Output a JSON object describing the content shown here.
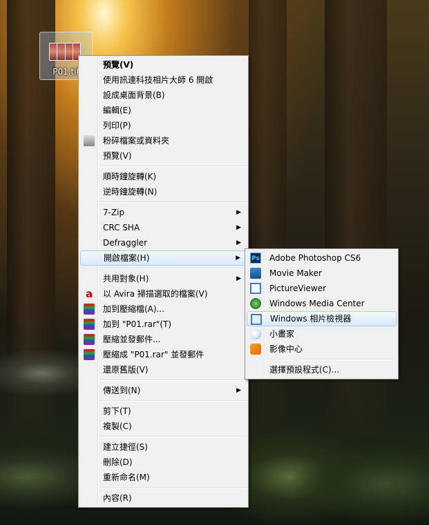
{
  "desktop": {
    "icon_label": "P01.tif"
  },
  "context_menu": {
    "groups": [
      [
        {
          "label": "預覽(V)",
          "bold": true
        },
        {
          "label": "使用訊連科技相片大師 6 開啟"
        },
        {
          "label": "設成桌面背景(B)"
        },
        {
          "label": "編輯(E)"
        },
        {
          "label": "列印(P)"
        },
        {
          "label": "粉碎檔案或資料夾",
          "icon": "shredder-icon"
        },
        {
          "label": "預覽(V)"
        }
      ],
      [
        {
          "label": "順時鐘旋轉(K)"
        },
        {
          "label": "逆時鐘旋轉(N)"
        }
      ],
      [
        {
          "label": "7-Zip",
          "submenu": true
        },
        {
          "label": "CRC SHA",
          "submenu": true
        },
        {
          "label": "Defraggler",
          "submenu": true
        },
        {
          "label": "開啟檔案(H)",
          "submenu": true,
          "highlight": true
        }
      ],
      [
        {
          "label": "共用對象(H)",
          "submenu": true
        },
        {
          "label": "以 Avira 掃描選取的檔案(V)",
          "icon": "avira-icon"
        },
        {
          "label": "加到壓縮檔(A)...",
          "icon": "winrar-icon"
        },
        {
          "label": "加到 \"P01.rar\"(T)",
          "icon": "winrar-icon"
        },
        {
          "label": "壓縮並發郵件...",
          "icon": "winrar-icon"
        },
        {
          "label": "壓縮成 \"P01.rar\" 並發郵件",
          "icon": "winrar-icon"
        },
        {
          "label": "還原舊版(V)"
        }
      ],
      [
        {
          "label": "傳送到(N)",
          "submenu": true
        }
      ],
      [
        {
          "label": "剪下(T)"
        },
        {
          "label": "複製(C)"
        }
      ],
      [
        {
          "label": "建立捷徑(S)"
        },
        {
          "label": "刪除(D)"
        },
        {
          "label": "重新命名(M)"
        }
      ],
      [
        {
          "label": "內容(R)"
        }
      ]
    ]
  },
  "open_with_submenu": {
    "programs": [
      {
        "label": "Adobe Photoshop CS6",
        "icon": "photoshop-icon",
        "icon_text": "Ps"
      },
      {
        "label": "Movie Maker",
        "icon": "movie-maker-icon"
      },
      {
        "label": "PictureViewer",
        "icon": "picture-viewer-icon"
      },
      {
        "label": "Windows Media Center",
        "icon": "media-center-icon"
      },
      {
        "label": "Windows 相片檢視器",
        "icon": "photo-viewer-icon",
        "highlight": true
      },
      {
        "label": "小畫家",
        "icon": "paint-icon"
      },
      {
        "label": "影像中心",
        "icon": "gallery-icon"
      }
    ],
    "choose_default": "選擇預設程式(C)..."
  },
  "submenu_arrow": "▶"
}
